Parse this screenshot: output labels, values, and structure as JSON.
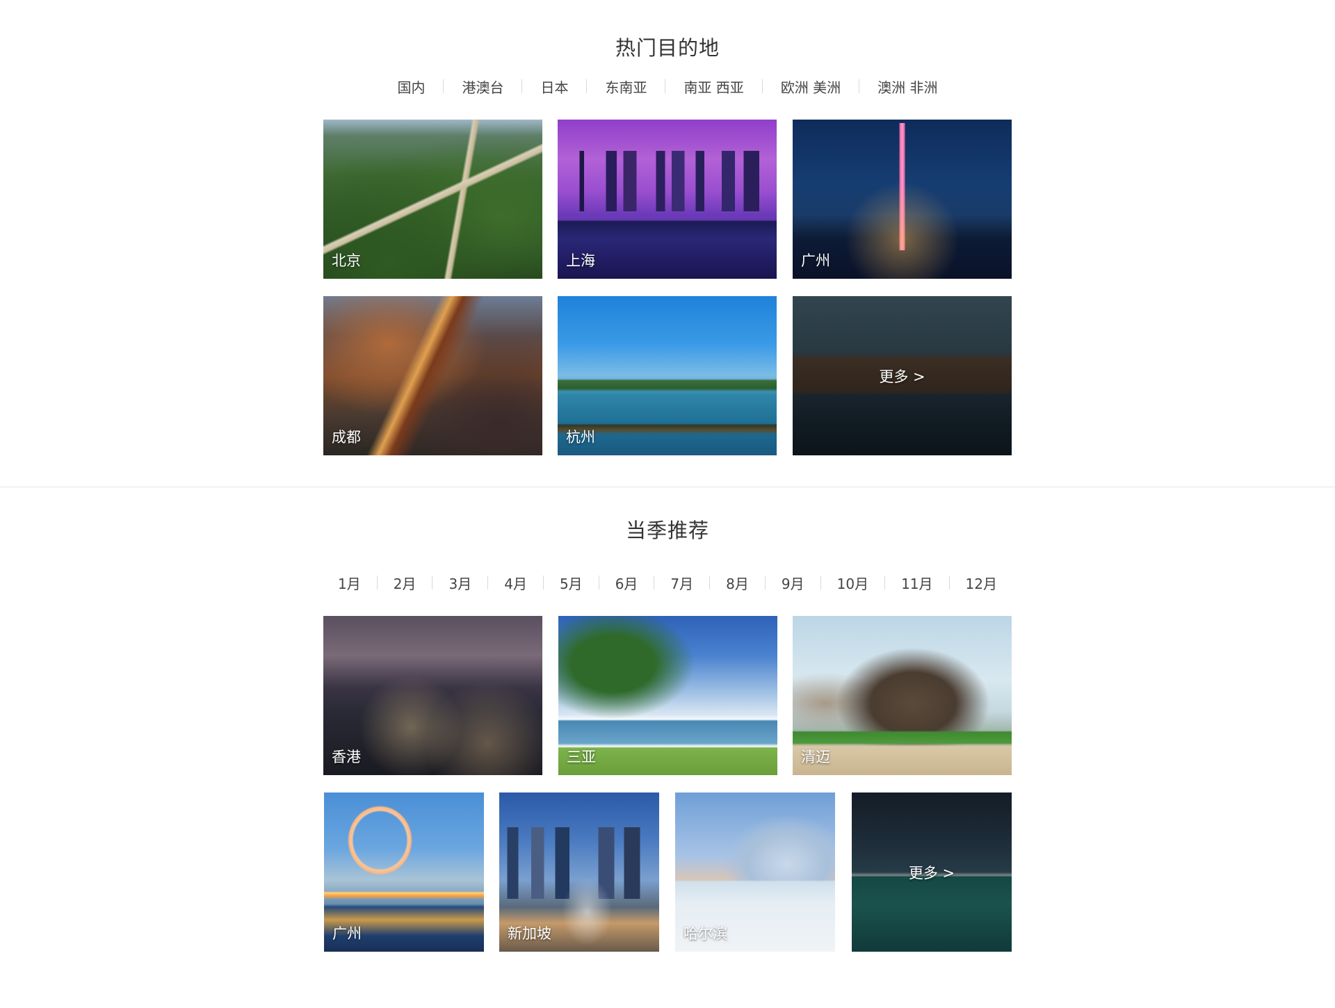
{
  "hot": {
    "title": "热门目的地",
    "tabs": [
      "国内",
      "港澳台",
      "日本",
      "东南亚",
      "南亚 西亚",
      "欧洲 美洲",
      "澳洲 非洲"
    ],
    "cards": [
      "北京",
      "上海",
      "广州",
      "成都",
      "杭州"
    ],
    "more": "更多 >"
  },
  "season": {
    "title": "当季推荐",
    "months": [
      "1月",
      "2月",
      "3月",
      "4月",
      "5月",
      "6月",
      "7月",
      "8月",
      "9月",
      "10月",
      "11月",
      "12月"
    ],
    "cards": [
      "香港",
      "三亚",
      "清迈",
      "广州",
      "新加坡",
      "哈尔滨"
    ],
    "more": "更多 >"
  }
}
